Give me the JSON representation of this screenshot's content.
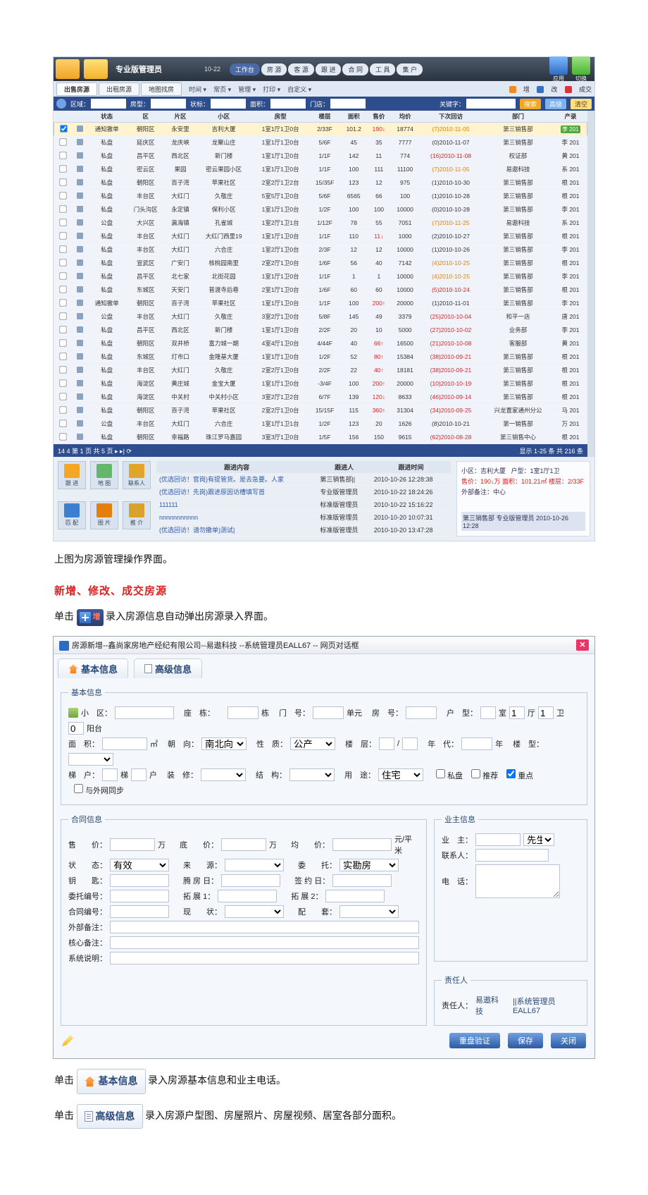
{
  "topbar": {
    "role": "专业版管理员",
    "date": "10-22",
    "tabs": [
      "工作台",
      "房 源",
      "客 源",
      "跟 进",
      "合 同",
      "工 具",
      "集 户"
    ],
    "actions": {
      "app": "应用",
      "tool": "切换"
    }
  },
  "subtabs": {
    "items": [
      "出售房源",
      "出租房源",
      "地图找房"
    ],
    "toolbar": [
      "时间 ▾",
      "常页 ▾",
      "管理 ▾",
      "打印 ▾",
      "自定义 ▾"
    ],
    "right": [
      {
        "label": "增",
        "cls": "bg-orange"
      },
      {
        "label": "改",
        "cls": "bg-blue"
      },
      {
        "label": "成交",
        "cls": "bg-red"
      }
    ]
  },
  "filters": {
    "labels": [
      "区域：",
      "房型：",
      "状标：",
      "面积：",
      "门店："
    ],
    "keyword_label": "关键字：",
    "buttons": [
      "搜索",
      "高级",
      "清空"
    ],
    "scroll_on": true
  },
  "grid": {
    "headers": [
      "",
      "",
      "状态",
      "区",
      "片区",
      "小区",
      "房型",
      "楼层",
      "面积",
      "售价",
      "均价",
      "下次回访",
      "部门",
      "产录"
    ],
    "rows": [
      {
        "sel": true,
        "st": "通知撤单",
        "a": "朝阳区",
        "b": "永安里",
        "c": "吉利大厦",
        "d": "1室1厅1卫0台",
        "e": "2/33F",
        "f": "101.2",
        "g": "190↓",
        "h": "18774",
        "i": "(7)2010-11-05",
        "i_cls": "orange",
        "j": "第三销售部",
        "k": "李 201",
        "k_badge": true
      },
      {
        "st": "私盘",
        "a": "延庆区",
        "b": "龙庆峡",
        "c": "龙聚山庄",
        "d": "1室1厅1卫0台",
        "e": "5/6F",
        "f": "45",
        "g": "35",
        "h": "7777",
        "i": "(0)2010-11-07",
        "j": "第三销售部",
        "k": "李 201"
      },
      {
        "st": "私盘",
        "a": "昌平区",
        "b": "西北区",
        "c": "新门楼",
        "d": "1室1厅1卫0台",
        "e": "1/1F",
        "f": "142",
        "g": "11",
        "h": "774",
        "i": "(16)2010-11-08",
        "i_cls": "red",
        "j": "权证部",
        "k": "黄 201"
      },
      {
        "st": "私盘",
        "a": "密云区",
        "b": "果园",
        "c": "密云果园小区",
        "d": "1室1厅1卫0台",
        "e": "1/1F",
        "f": "100",
        "g": "111",
        "h": "11100",
        "i": "(7)2010-11-05",
        "i_cls": "orange",
        "j": "易遨科技",
        "k": "系 201"
      },
      {
        "st": "私盘",
        "a": "朝阳区",
        "b": "百子湾",
        "c": "苹果社区",
        "d": "2室2厅1卫2台",
        "e": "15/35F",
        "f": "123",
        "g": "12",
        "h": "975",
        "i": "(1)2010-10-30",
        "j": "第三销售部",
        "k": "根 201"
      },
      {
        "st": "私盘",
        "a": "丰台区",
        "b": "大红门",
        "c": "久敬庄",
        "d": "5室5厅1卫0台",
        "e": "5/6F",
        "f": "6565",
        "g": "66",
        "h": "100",
        "i": "(1)2010-10-28",
        "j": "第三销售部",
        "k": "根 201"
      },
      {
        "st": "私盘",
        "a": "门头沟区",
        "b": "永定镇",
        "c": "保利小区",
        "d": "1室1厅1卫0台",
        "e": "1/2F",
        "f": "100",
        "g": "100",
        "h": "10000",
        "i": "(0)2010-10-28",
        "j": "第三销售部",
        "k": "李 201"
      },
      {
        "st": "公盘",
        "a": "大兴区",
        "b": "瀛海镇",
        "c": "孔雀城",
        "d": "1室2厅1卫1台",
        "e": "1/12F",
        "f": "78",
        "g": "55",
        "h": "7051",
        "i": "(7)2010-11-25",
        "i_cls": "orange",
        "j": "易遨科技",
        "k": "系 201"
      },
      {
        "st": "私盘",
        "a": "丰台区",
        "b": "大红门",
        "c": "大红门西里19",
        "d": "1室1厅1卫0台",
        "e": "1/1F",
        "f": "110",
        "g": "11↓",
        "h": "1000",
        "i": "(2)2010-10-27",
        "j": "第三销售部",
        "k": "根 201"
      },
      {
        "st": "私盘",
        "a": "丰台区",
        "b": "大红门",
        "c": "六合庄",
        "d": "1室2厅1卫0台",
        "e": "2/3F",
        "f": "12",
        "g": "12",
        "h": "10000",
        "i": "(1)2010-10-26",
        "j": "第三销售部",
        "k": "李 201"
      },
      {
        "st": "私盘",
        "a": "宣武区",
        "b": "广安门",
        "c": "核桃园南里",
        "d": "2室2厅1卫0台",
        "e": "1/6F",
        "f": "56",
        "g": "40",
        "h": "7142",
        "i": "(4)2010-10-25",
        "i_cls": "orange",
        "j": "第三销售部",
        "k": "根 201"
      },
      {
        "st": "私盘",
        "a": "昌平区",
        "b": "北七家",
        "c": "北街花园",
        "d": "1室1厅1卫0台",
        "e": "1/1F",
        "f": "1",
        "g": "1",
        "h": "10000",
        "i": "(4)2010-10-25",
        "i_cls": "orange",
        "j": "第三销售部",
        "k": "李 201"
      },
      {
        "st": "私盘",
        "a": "东城区",
        "b": "天安门",
        "c": "普渡寺后巷",
        "d": "2室1厅1卫0台",
        "e": "1/6F",
        "f": "60",
        "g": "60",
        "h": "10000",
        "i": "(5)2010-10-24",
        "i_cls": "red",
        "j": "第三销售部",
        "k": "根 201"
      },
      {
        "st": "通知撤单",
        "a": "朝阳区",
        "b": "百子湾",
        "c": "苹果社区",
        "d": "1室1厅1卫0台",
        "e": "1/1F",
        "f": "100",
        "g": "200↑",
        "h": "20000",
        "i": "(1)2010-11-01",
        "j": "第三销售部",
        "k": "李 201"
      },
      {
        "st": "公盘",
        "a": "丰台区",
        "b": "大红门",
        "c": "久敬庄",
        "d": "3室2厅1卫0台",
        "e": "5/8F",
        "f": "145",
        "g": "49",
        "h": "3379",
        "i": "(25)2010-10-04",
        "i_cls": "red",
        "j": "和平一店",
        "k": "唐 201"
      },
      {
        "st": "私盘",
        "a": "昌平区",
        "b": "西北区",
        "c": "新门楼",
        "d": "1室1厅1卫0台",
        "e": "2/2F",
        "f": "20",
        "g": "10",
        "h": "5000",
        "i": "(27)2010-10-02",
        "i_cls": "red",
        "j": "业务部",
        "k": "李 201"
      },
      {
        "st": "私盘",
        "a": "朝阳区",
        "b": "双井桥",
        "c": "富力城一期",
        "d": "4室4厅1卫0台",
        "e": "4/44F",
        "f": "40",
        "g": "66↑",
        "h": "16500",
        "i": "(21)2010-10-08",
        "i_cls": "red",
        "j": "客服部",
        "k": "黄 201"
      },
      {
        "st": "私盘",
        "a": "东城区",
        "b": "灯市口",
        "c": "金隆基大厦",
        "d": "1室1厅1卫0台",
        "e": "1/2F",
        "f": "52",
        "g": "80↑",
        "h": "15384",
        "i": "(38)2010-09-21",
        "i_cls": "red",
        "j": "第三销售部",
        "k": "根 201"
      },
      {
        "st": "私盘",
        "a": "丰台区",
        "b": "大红门",
        "c": "久敬庄",
        "d": "2室2厅1卫0台",
        "e": "2/2F",
        "f": "22",
        "g": "40↑",
        "h": "18181",
        "i": "(38)2010-09-21",
        "i_cls": "red",
        "j": "第三销售部",
        "k": "根 201"
      },
      {
        "st": "私盘",
        "a": "海淀区",
        "b": "黄庄城",
        "c": "金宝大厦",
        "d": "1室1厅1卫0台",
        "e": "-3/4F",
        "f": "100",
        "g": "200↑",
        "h": "20000",
        "i": "(10)2010-10-19",
        "i_cls": "red",
        "j": "第三销售部",
        "k": "根 201"
      },
      {
        "st": "私盘",
        "a": "海淀区",
        "b": "中关村",
        "c": "中关村小区",
        "d": "3室2厅1卫2台",
        "e": "6/7F",
        "f": "139",
        "g": "120↓",
        "h": "8633",
        "i": "(46)2010-09-14",
        "i_cls": "red",
        "j": "第三销售部",
        "k": "根 201"
      },
      {
        "st": "私盘",
        "a": "朝阳区",
        "b": "百子湾",
        "c": "苹果社区",
        "d": "2室2厅1卫0台",
        "e": "15/15F",
        "f": "115",
        "g": "360↑",
        "h": "31304",
        "i": "(34)2010-09-25",
        "i_cls": "red",
        "j": "兴龙置家通州分公",
        "k": "马 201"
      },
      {
        "st": "公盘",
        "a": "丰台区",
        "b": "大红门",
        "c": "六合庄",
        "d": "1室1厅1卫1台",
        "e": "1/2F",
        "f": "123",
        "g": "20",
        "h": "1626",
        "i": "(8)2010-10-21",
        "j": "第一销售部",
        "k": "万 201"
      },
      {
        "st": "私盘",
        "a": "朝阳区",
        "b": "幸福路",
        "c": "珠江罗马嘉园",
        "d": "3室3厅1卫0台",
        "e": "1/5F",
        "f": "156",
        "g": "150",
        "h": "9615",
        "i": "(62)2010-08-28",
        "i_cls": "red",
        "j": "第三销售中心",
        "k": "根 201"
      }
    ],
    "footer_left": "14 4 第 1 页 共 5 页 ▸ ▸| ⟳",
    "footer_right": "显示 1-25 条 共 216 条"
  },
  "side_icons": [
    "跟 进",
    "地 图",
    "联系人",
    "匹 配",
    "图 片",
    "推 介"
  ],
  "followup": {
    "headers": [
      "跟进内容",
      "跟进人",
      "跟进时间"
    ],
    "rows": [
      {
        "c": "(优选回访！官岗)有提管货。是去急要。人家",
        "p": "第三销售部||",
        "t": "2010-10-26 12:28:38"
      },
      {
        "c": "(优选回访！先岗)跟进原因访槽填写首",
        "p": "专业版管理员",
        "t": "2010-10-22 18:24:26"
      },
      {
        "c": "111111",
        "p": "标准版管理员",
        "t": "2010-10-22 15:16:22"
      },
      {
        "c": "nnnnnnnnnnn",
        "p": "标准版管理员",
        "t": "2010-10-20 10:07:31"
      },
      {
        "c": "(优选回访！请勿撤单)测试|",
        "p": "标准版管理员",
        "t": "2010-10-20 13:47:28"
      }
    ],
    "info": {
      "l1": "小区：吉利大厦",
      "l1r": "户型：1室1厅1卫",
      "l2": "售价：190↓万 面积：101.21㎡ 楼层：2/33F",
      "l3": "外部备注：中心",
      "l4": "第三销售部    专业版管理员  2010-10-26 12:28"
    }
  },
  "doc": {
    "caption1": "上图为房源管理操作界面。",
    "heading1": "新增、修改、成交房源",
    "line1a": "单击",
    "line1_btn": "增",
    "line1b": "录入房源信息自动弹出房源录入界面。",
    "tab_basic": "基本信息",
    "tab_adv": "高级信息",
    "line2a": "单击",
    "line2b": "录入房源基本信息和业主电话。",
    "line3a": "单击",
    "line3b": "录入房源户型图、房屋照片、房屋视频、居室各部分面积。"
  },
  "dialog": {
    "title": "房源新增--鑫尚家房地产经纪有限公司--易遨科技 --系统管理员EALL67 -- 网页对话框",
    "tabs": [
      "基本信息",
      "高级信息"
    ],
    "basic": {
      "legend": "基本信息",
      "labels": {
        "district": "小　区：",
        "seat": "座　栋：",
        "seat_unit": "栋",
        "door": "门　号：",
        "unit": "单元",
        "room": "房　号：",
        "htype": "户　型：",
        "shi": "室",
        "ting": "厅",
        "wei": "卫",
        "balcony": "阳台",
        "area": "面　积：",
        "m2": "㎡",
        "orient": "朝　向：",
        "orient_v": "南北向",
        "nature": "性　质：",
        "nature_v": "公产",
        "floor": "楼　层：",
        "slash": "/",
        "year": "年　代：",
        "year_u": "年",
        "btype": "楼　型：",
        "ti": "梯　户：",
        "ti_u": "梯",
        "hu_u": "户",
        "deco": "装　修：",
        "struct": "结　构：",
        "use": "用　途：",
        "use_v": "住宅",
        "cb1": "私盘",
        "cb2": "推荐",
        "cb3": "重点",
        "cb4": "与外网同步"
      }
    },
    "contract": {
      "legend": "合同信息",
      "l": {
        "price": "售　　价：",
        "wan": "万",
        "base": "底　　价：",
        "avg": "均　　价：",
        "unit": "元/平米",
        "status": "状　　态：",
        "status_v": "有效",
        "src": "来　　源：",
        "delegate": "委　　托：",
        "delegate_v": "实勘房",
        "key": "钥　　匙：",
        "rentday": "腾 房 日：",
        "signday": "签 约 日：",
        "delegateno": "委托编号：",
        "ext1": "拓 展 1：",
        "ext2": "拓 展 2：",
        "contractno": "合同编号：",
        "cur": "现　　状：",
        "suite": "配　　套：",
        "extnote": "外部备注：",
        "corenote": "核心备注：",
        "sysnote": "系统说明："
      }
    },
    "owner": {
      "legend": "业主信息",
      "l": {
        "owner": "业　主：",
        "sir": "先生",
        "contact": "联系人：",
        "tel": "电　话："
      }
    },
    "resp": {
      "legend": "责任人",
      "label": "责任人：",
      "v1": "易遨科技",
      "v2": "||系统管理员EALL67"
    },
    "btns": {
      "verify": "重盘验证",
      "save": "保存",
      "close": "关闭"
    }
  }
}
